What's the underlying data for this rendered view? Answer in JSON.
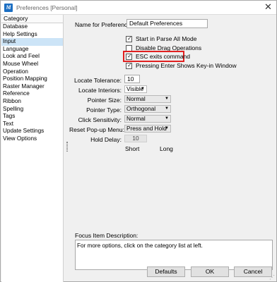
{
  "window": {
    "title": "Preferences [Personal]",
    "close": "✕"
  },
  "sidebar": {
    "header": "Category",
    "items": [
      {
        "label": "Database"
      },
      {
        "label": "Help Settings"
      },
      {
        "label": "Input"
      },
      {
        "label": "Language"
      },
      {
        "label": "Look and Feel"
      },
      {
        "label": "Mouse Wheel"
      },
      {
        "label": "Operation"
      },
      {
        "label": "Position Mapping"
      },
      {
        "label": "Raster Manager"
      },
      {
        "label": "Reference"
      },
      {
        "label": "Ribbon"
      },
      {
        "label": "Spelling"
      },
      {
        "label": "Tags"
      },
      {
        "label": "Text"
      },
      {
        "label": "Update Settings"
      },
      {
        "label": "View Options"
      }
    ],
    "selected": "Input"
  },
  "name_for_preferences": {
    "label": "Name for Preferences:",
    "value": "Default Preferences"
  },
  "checkboxes": [
    {
      "label": "Start in Parse All Mode",
      "checked": true
    },
    {
      "label": "Disable Drag Operations",
      "checked": false
    },
    {
      "label": "ESC exits command",
      "checked": true
    },
    {
      "label": "Pressing Enter Shows Key-in Window",
      "checked": true
    }
  ],
  "locate_tolerance": {
    "label": "Locate Tolerance:",
    "value": "10"
  },
  "locate_interiors": {
    "label": "Locate Interiors:",
    "value": "Visible"
  },
  "pointer_size": {
    "label": "Pointer Size:",
    "value": "Normal"
  },
  "pointer_type": {
    "label": "Pointer Type:",
    "value": "Orthogonal"
  },
  "click_sensitivity": {
    "label": "Click Sensitivity:",
    "value": "Normal"
  },
  "reset_popup_menu": {
    "label": "Reset Pop-up Menu:",
    "value": "Press and Hold"
  },
  "hold_delay": {
    "label": "Hold Delay:",
    "value": "10",
    "short": "Short",
    "long": "Long"
  },
  "focus_item": {
    "label": "Focus Item Description:",
    "text": "For more options, click on the category list at left."
  },
  "buttons": {
    "defaults": "Defaults",
    "ok": "OK",
    "cancel": "Cancel"
  },
  "colors": {
    "selected_bg": "#cce4f7",
    "highlight_border": "#e02020",
    "app_icon": "#1b6ec2"
  },
  "icons": {
    "app": "microstation-icon",
    "close": "close-icon",
    "check": "checkmark-icon",
    "dropdown": "chevron-down-icon"
  }
}
